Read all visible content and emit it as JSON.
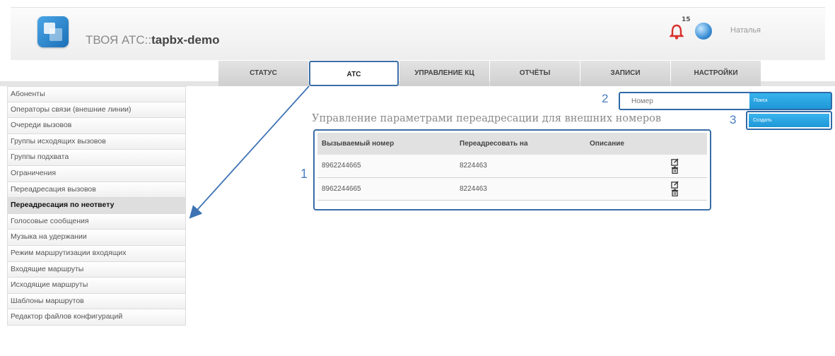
{
  "header": {
    "app_title_prefix": "ТВОЯ АТС::",
    "app_title_name": "tapbx-demo",
    "notification_count": "15",
    "user_name": "Наталья"
  },
  "tabs": [
    {
      "label": "СТАТУС"
    },
    {
      "label": "АТС"
    },
    {
      "label": "УПРАВЛЕНИЕ КЦ"
    },
    {
      "label": "ОТЧЁТЫ"
    },
    {
      "label": "ЗАПИСИ"
    },
    {
      "label": "НАСТРОЙКИ"
    }
  ],
  "active_tab": "АТС",
  "sidebar": {
    "items": [
      {
        "label": "Абоненты"
      },
      {
        "label": "Операторы связи (внешние линии)"
      },
      {
        "label": "Очереди вызовов"
      },
      {
        "label": "Группы исходящих вызовов"
      },
      {
        "label": "Группы подхвата"
      },
      {
        "label": "Ограничения"
      },
      {
        "label": "Переадресация вызовов"
      },
      {
        "label": "Переадресация по неответу"
      },
      {
        "label": "Голосовые сообщения"
      },
      {
        "label": "Музыка на удержании"
      },
      {
        "label": "Режим маршрутизации входящих"
      },
      {
        "label": "Входящие маршруты"
      },
      {
        "label": "Исходящие маршруты"
      },
      {
        "label": "Шаблоны маршрутов"
      },
      {
        "label": "Редактор файлов конфигураций"
      }
    ],
    "active_item": "Переадресация по неответу"
  },
  "annotations": {
    "marker_1": "1",
    "marker_2": "2",
    "marker_3": "3"
  },
  "search": {
    "placeholder": "Номер",
    "button_label": "Поиск"
  },
  "create_button_label": "Создать",
  "main": {
    "title": "Управление параметрами переадресации для внешних номеров"
  },
  "table": {
    "columns": [
      "Вызываемый номер",
      "Переадресовать на",
      "Описание",
      ""
    ],
    "rows": [
      {
        "called_number": "8962244665",
        "forward_to": "8224463",
        "description": ""
      },
      {
        "called_number": "8962244665",
        "forward_to": "8224463",
        "description": ""
      }
    ]
  },
  "colors": {
    "accent_blue": "#1e97d6",
    "highlight_border": "#2f6aa8",
    "bell_red": "#d9302c"
  }
}
